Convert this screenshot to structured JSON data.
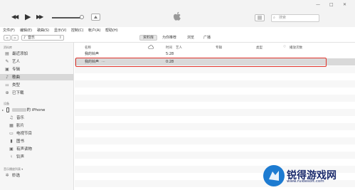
{
  "window": {
    "min_glyph": "—",
    "max_glyph": "□",
    "close_glyph": "✕"
  },
  "toolbar": {
    "prev_glyph": "◀◀",
    "play_glyph": "▶",
    "next_glyph": "▶▶",
    "search_placeholder": "搜索"
  },
  "menubar": {
    "items": [
      "文件(F)",
      "编辑(E)",
      "歌曲(S)",
      "显示(V)",
      "控制(C)",
      "帐户(A)",
      "帮助(H)"
    ]
  },
  "nav": {
    "back": "<",
    "forward": ">",
    "library_select": "音乐",
    "tabs": [
      "资料库",
      "为你推荐",
      "浏览",
      "广播"
    ],
    "active_tab": "资料库"
  },
  "sidebar": {
    "library_header": "资料库",
    "library_items": [
      {
        "label": "最近添加",
        "icon": "recent-icon"
      },
      {
        "label": "艺人",
        "icon": "artist-icon"
      },
      {
        "label": "专辑",
        "icon": "album-icon"
      },
      {
        "label": "歌曲",
        "icon": "song-icon",
        "selected": true
      },
      {
        "label": "类型",
        "icon": "genre-icon"
      },
      {
        "label": "已下载",
        "icon": "download-icon"
      }
    ],
    "devices_header": "设备",
    "device_name": "的 iPhone",
    "device_items": [
      {
        "label": "音乐",
        "icon": "music-note-icon"
      },
      {
        "label": "影片",
        "icon": "film-icon"
      },
      {
        "label": "电视节目",
        "icon": "tv-icon"
      },
      {
        "label": "图书",
        "icon": "book-icon"
      },
      {
        "label": "有声读物",
        "icon": "audiobook-icon"
      },
      {
        "label": "铃声",
        "icon": "bell-icon"
      }
    ],
    "genius_header": "音乐播放列表 ▾",
    "genius_items": [
      {
        "label": "妙选",
        "icon": "genius-icon"
      }
    ]
  },
  "table": {
    "columns": [
      "名称",
      "时间",
      "艺人",
      "专辑",
      "类型",
      "♡",
      "播放次数"
    ],
    "rows": [
      {
        "name": "我的铃声",
        "time": "5:28",
        "dots": ""
      },
      {
        "name": "我的铃声",
        "time": "0:28",
        "dots": "···",
        "selected": true
      }
    ]
  },
  "watermark": {
    "text": "锐得游戏网",
    "url": "www.ruidesoft.com"
  },
  "colors": {
    "highlight_border": "#e0332b",
    "selection_bg": "#d9d9d9",
    "watermark_blue": "#1d7bd1"
  }
}
